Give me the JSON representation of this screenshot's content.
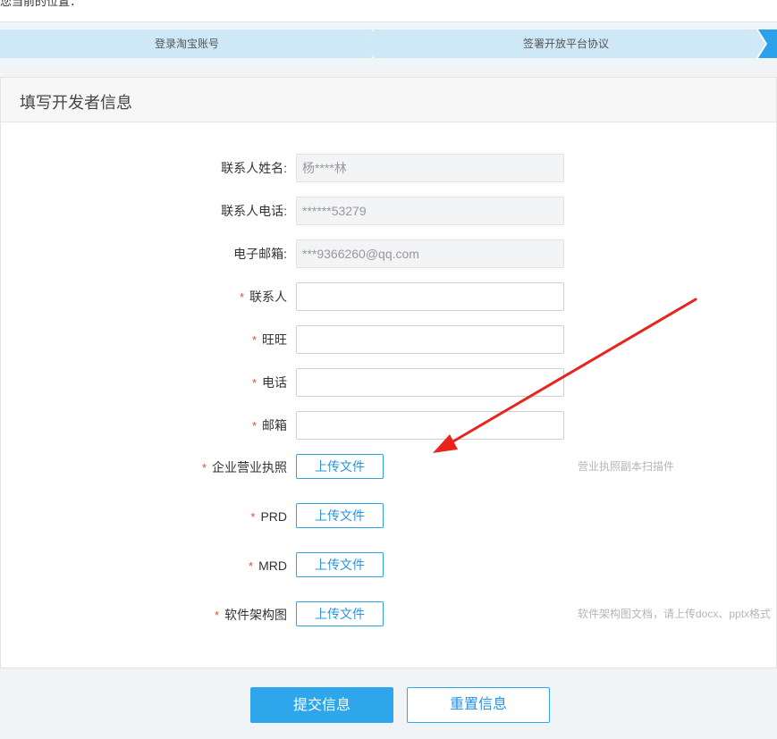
{
  "breadcrumb": {
    "text": "您当前的位置："
  },
  "steps": [
    {
      "label": "登录淘宝账号"
    },
    {
      "label": "签署开放平台协议"
    }
  ],
  "form": {
    "title": "填写开发者信息",
    "required_mark": "*",
    "fields": {
      "contact_name": {
        "label": "联系人姓名:",
        "value": "杨****林"
      },
      "contact_phone": {
        "label": "联系人电话:",
        "value": "******53279"
      },
      "email": {
        "label": "电子邮箱:",
        "value": "***9366260@qq.com"
      },
      "contact": {
        "label": "联系人",
        "value": ""
      },
      "wangwang": {
        "label": "旺旺",
        "value": ""
      },
      "phone": {
        "label": "电话",
        "value": ""
      },
      "mailbox": {
        "label": "邮箱",
        "value": ""
      }
    },
    "uploads": {
      "license": {
        "label": "企业营业执照",
        "button": "上传文件",
        "hint": "营业执照副本扫描件"
      },
      "prd": {
        "label": "PRD",
        "button": "上传文件"
      },
      "mrd": {
        "label": "MRD",
        "button": "上传文件"
      },
      "architecture": {
        "label": "软件架构图",
        "button": "上传文件",
        "hint": "软件架构图文档，请上传docx、pptx格式"
      }
    }
  },
  "actions": {
    "submit": "提交信息",
    "reset": "重置信息"
  },
  "colors": {
    "accent": "#2ea6ec",
    "required": "#e64c3c",
    "annotation_arrow": "#e8241c"
  }
}
